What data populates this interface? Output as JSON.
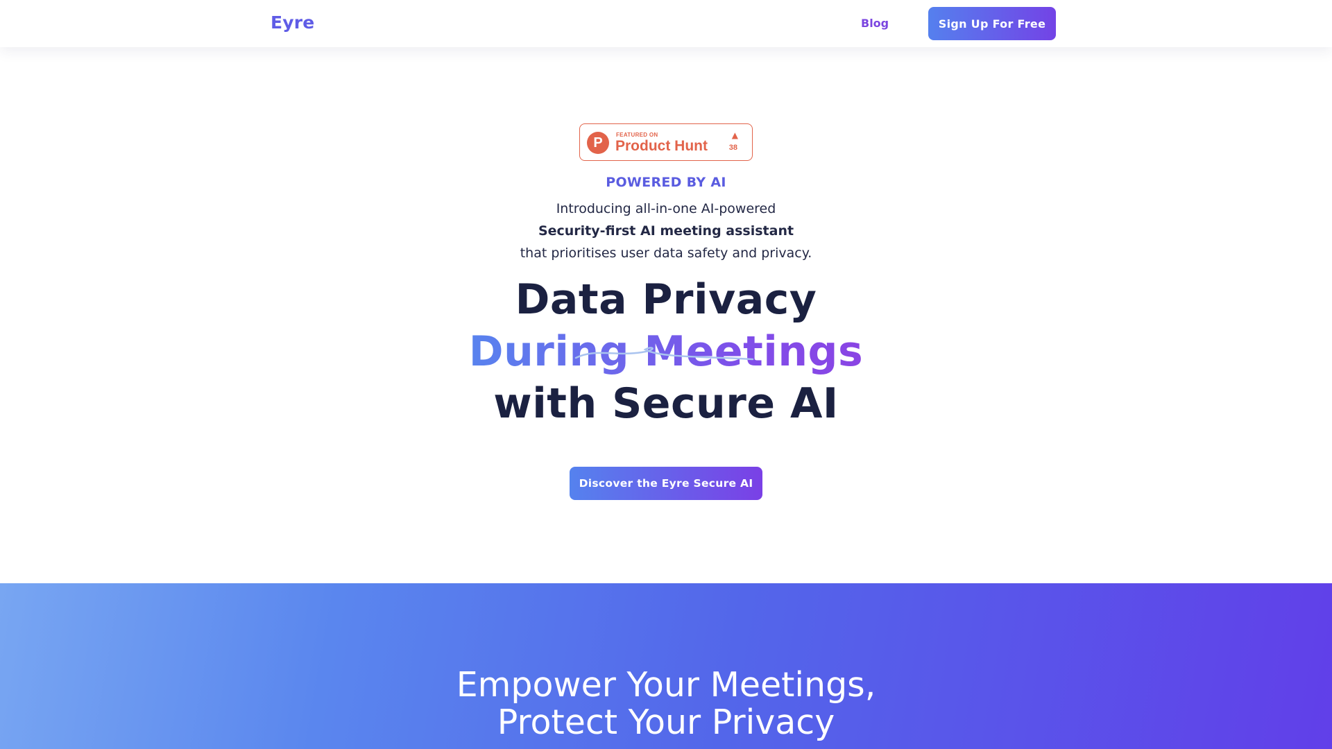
{
  "header": {
    "logo": "Eyre",
    "nav_blog": "Blog",
    "signup_label": "Sign Up For Free"
  },
  "hero": {
    "product_hunt": {
      "featured": "FEATURED ON",
      "name": "Product Hunt",
      "logo_letter": "P",
      "upvote_arrow": "▲",
      "upvotes": "38"
    },
    "eyebrow": "POWERED BY AI",
    "intro_line_1": "Introducing all-in-one AI-powered",
    "intro_line_2": "Security-first AI meeting assistant",
    "intro_line_3": "that prioritises user data safety and privacy.",
    "headline_line_1": "Data Privacy",
    "headline_line_2": "During Meetings",
    "headline_line_3": "with Secure AI",
    "cta_label": "Discover the Eyre Secure AI"
  },
  "banner": {
    "line_1": "Empower Your Meetings,",
    "line_2": "Protect Your Privacy"
  },
  "colors": {
    "brand": "#5f5ce6",
    "accent_purple": "#7b45e0",
    "product_hunt": "#e2634a",
    "heading": "#1b2141"
  },
  "icons": {
    "product_hunt_logo": "product-hunt-logo-icon",
    "upvote": "upvote-triangle-icon",
    "underline": "squiggle-underline-icon"
  }
}
